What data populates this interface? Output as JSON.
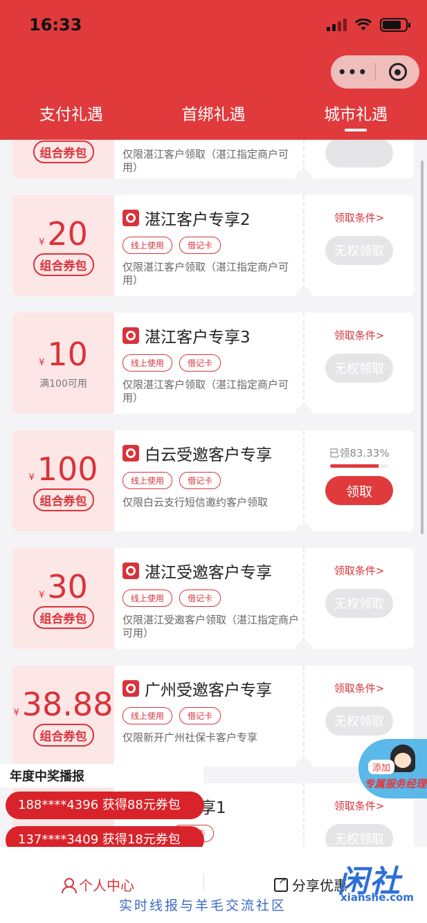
{
  "status": {
    "time": "16:33"
  },
  "tabs": [
    {
      "label": "支付礼遇",
      "active": false
    },
    {
      "label": "首绑礼遇",
      "active": false
    },
    {
      "label": "城市礼遇",
      "active": true
    }
  ],
  "colors": {
    "brand": "#e03a3c",
    "disabled": "#e5e5e7",
    "coupon_bg": "#fde6e6"
  },
  "cards": [
    {
      "pill": "组合券包",
      "desc": "仅限湛江客户领取（湛江指定商户可用）"
    },
    {
      "yen": "¥",
      "amount": "20",
      "pill": "组合券包",
      "title": "湛江客户专享2",
      "tags": [
        "线上使用",
        "借记卡"
      ],
      "desc": "仅限湛江客户领取（湛江指定商户可用）",
      "cond": "领取条件>",
      "button": "无权领取"
    },
    {
      "yen": "¥",
      "amount": "10",
      "sub": "满100可用",
      "title": "湛江客户专享3",
      "tags": [
        "线上使用",
        "借记卡"
      ],
      "desc": "仅限湛江客户领取（湛江指定商户可用）",
      "cond": "领取条件>",
      "button": "无权领取"
    },
    {
      "yen": "¥",
      "amount": "100",
      "pill": "组合券包",
      "title": "白云受邀客户专享",
      "tags": [
        "线上使用",
        "借记卡"
      ],
      "desc": "仅限白云支行短信邀约客户领取",
      "progress_label": "已领83.33%",
      "progress": 0.8333,
      "button": "领取"
    },
    {
      "yen": "¥",
      "amount": "30",
      "pill": "组合券包",
      "title": "湛江受邀客户专享",
      "tags": [
        "线上使用",
        "借记卡"
      ],
      "desc": "仅限湛江受邀客户领取（湛江指定商户可用）",
      "cond": "领取条件>",
      "button": "无权领取"
    },
    {
      "yen": "¥",
      "amount": "38.88",
      "pill": "组合券包",
      "title": "广州受邀客户专享",
      "tags": [
        "线上使用",
        "借记卡"
      ],
      "desc": "仅限新开广州社保卡客户专享",
      "cond": "领取条件>",
      "button": "无权领取"
    },
    {
      "title": "邀客户专享1",
      "tags": [
        "借记卡"
      ],
      "cond": "领取条件>",
      "button": "无权领取"
    }
  ],
  "broadcast": {
    "title": "年度中奖播报",
    "items": [
      "188****4396 获得88元券包",
      "137****3409 获得18元券包"
    ]
  },
  "float_manager": {
    "add": "添加",
    "label": "专属服务经理"
  },
  "bottom_nav": {
    "personal": "个人中心",
    "share": "分享优惠"
  },
  "watermark": {
    "logo": "闲社",
    "domain": "xianshe.com",
    "slogan": "实时线报与羊毛交流社区"
  }
}
